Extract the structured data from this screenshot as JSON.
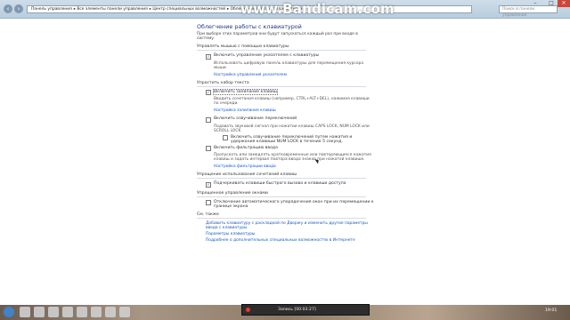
{
  "watermark": "www.Bandicam.com",
  "toolbar": {
    "breadcrumb": [
      "Панель управления",
      "Все элементы панели управления",
      "Центр специальных возможностей",
      "Облегчение работы с клавиатурой"
    ],
    "search_placeholder": "Поиск в панели управления"
  },
  "page": {
    "title": "Облегчение работы с клавиатурой",
    "description": "При выборе этих параметров они будут запускаться каждый раз при входе в систему."
  },
  "sections": {
    "mouse": {
      "title": "Управлять мышью с помощью клавиатуры",
      "checkbox_label": "Включить управление указателем с клавиатуры",
      "checked": true,
      "sub": "Использовать цифровую панель клавиатуры для перемещения курсора мыши.",
      "link": "Настройка управления указателем"
    },
    "typing": {
      "title": "Упростить набор текста",
      "sticky_label": "Включить залипание клавиш",
      "sticky_checked": true,
      "sticky_sub": "Вводить сочетания клавиш (например, CTRL+ALT+DEL), нажимая клавиши по очереди.",
      "sticky_link": "Настройка залипания клавиш",
      "toggle_label": "Включить озвучивание переключений",
      "toggle_checked": false,
      "toggle_sub": "Подавать звуковой сигнал при нажатии клавиш CAPS LOCK, NUM LOCK или SCROLL LOCK",
      "toggle_nested_label": "Включить озвучивание переключений путем нажатия и удержания клавиши NUM LOCK в течение 5 секунд.",
      "toggle_nested_checked": false,
      "filter_label": "Включить фильтрацию ввода",
      "filter_checked": false,
      "filter_sub": "Пропускать или замедлять кратковременные или повторяющиеся нажатия клавиш и задать интервал повтора ввода знаков при нажатой клавише.",
      "filter_link": "Настройка фильтрации ввода"
    },
    "shortcuts": {
      "title": "Упрощение использования сочетаний клавиш",
      "checkbox_label": "Подчеркивать клавиши быстрого вызова и клавиши доступа",
      "checked": true
    },
    "windows": {
      "title": "Упрощенное управление окнами",
      "checkbox_label": "Отключение автоматического упорядочения окон при их перемещении к границе экрана",
      "checked": false
    },
    "see_also": {
      "title": "См. также",
      "links": [
        "Добавить клавиатуру с раскладкой по Дворжу и изменить другие параметры ввода с клавиатуры",
        "Параметры клавиатуры",
        "Подробнее о дополнительных специальных возможностях в Интернете"
      ]
    }
  },
  "recorder": {
    "label": "Запись [00:03:27]"
  },
  "clock": "19:01"
}
